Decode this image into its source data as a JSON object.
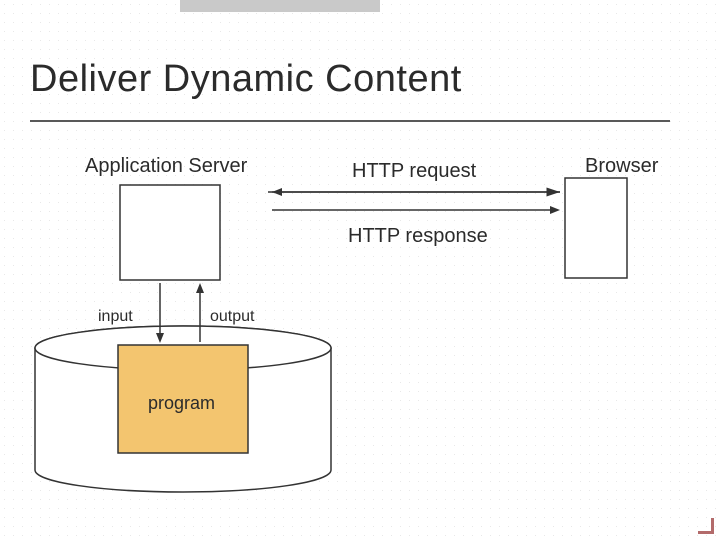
{
  "title": "Deliver Dynamic Content",
  "labels": {
    "application_server": "Application Server",
    "browser": "Browser",
    "http_request": "HTTP request",
    "http_response": "HTTP response",
    "input": "input",
    "output": "output",
    "program": "program"
  },
  "colors": {
    "program_fill": "#f3c56f",
    "lines": "#333333",
    "title": "#2b2b2b"
  }
}
